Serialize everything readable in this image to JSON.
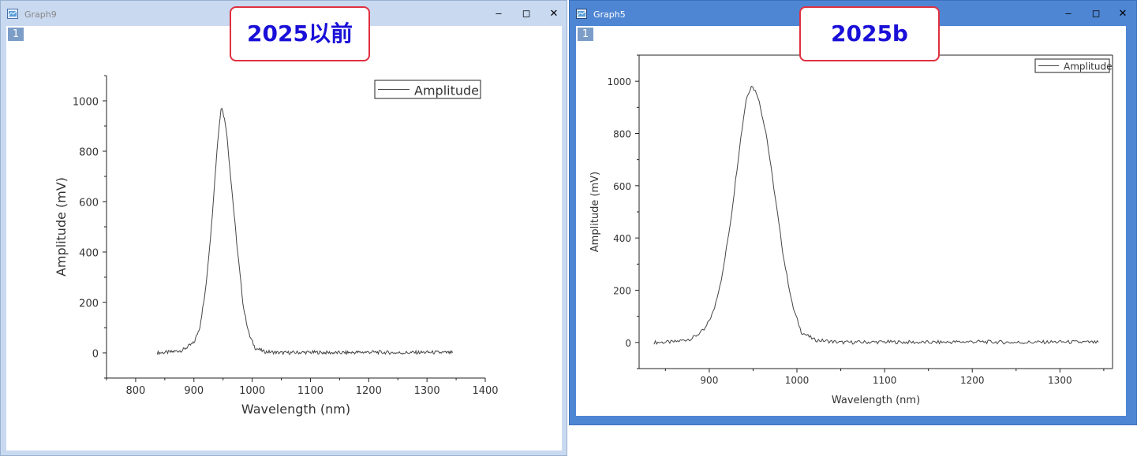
{
  "windows": [
    {
      "title": "Graph9",
      "layer_badge": "1",
      "callout": "2025以前",
      "chart_data": {
        "type": "line",
        "xlabel": "Wavelength (nm)",
        "ylabel": "Amplitude (mV)",
        "xlim": [
          750,
          1400
        ],
        "ylim": [
          -100,
          1100
        ],
        "xticks": [
          800,
          900,
          1000,
          1100,
          1200,
          1300,
          1400
        ],
        "yticks": [
          0,
          200,
          400,
          600,
          800,
          1000
        ],
        "grid": false,
        "legend": "top-right",
        "series": [
          {
            "name": "Amplitude",
            "x": [
              837,
              860,
              880,
              900,
              910,
              920,
              930,
              940,
              947,
              955,
              965,
              975,
              985,
              995,
              1005,
              1020,
              1050,
              1100,
              1150,
              1200,
              1250,
              1300,
              1345
            ],
            "y": [
              0,
              3,
              10,
              40,
              100,
              250,
              500,
              820,
              985,
              900,
              650,
              400,
              180,
              70,
              20,
              5,
              0,
              2,
              0,
              3,
              0,
              2,
              0
            ]
          }
        ]
      }
    },
    {
      "title": "Graph5",
      "layer_badge": "1",
      "callout": "2025b",
      "chart_data": {
        "type": "line",
        "xlabel": "Wavelength (nm)",
        "ylabel": "Amplitude (mV)",
        "xlim": [
          820,
          1360
        ],
        "ylim": [
          -100,
          1100
        ],
        "xticks": [
          900,
          1000,
          1100,
          1200,
          1300
        ],
        "yticks": [
          0,
          200,
          400,
          600,
          800,
          1000
        ],
        "grid": false,
        "legend": "top-right",
        "series": [
          {
            "name": "Amplitude",
            "x": [
              837,
              860,
              880,
              895,
              905,
              915,
              925,
              935,
              942,
              948,
              955,
              965,
              975,
              985,
              995,
              1005,
              1020,
              1050,
              1100,
              1150,
              1200,
              1250,
              1300,
              1345
            ],
            "y": [
              0,
              2,
              15,
              50,
              120,
              260,
              480,
              760,
              930,
              985,
              950,
              800,
              560,
              320,
              140,
              40,
              10,
              0,
              2,
              0,
              3,
              0,
              2,
              0
            ]
          }
        ]
      }
    }
  ]
}
